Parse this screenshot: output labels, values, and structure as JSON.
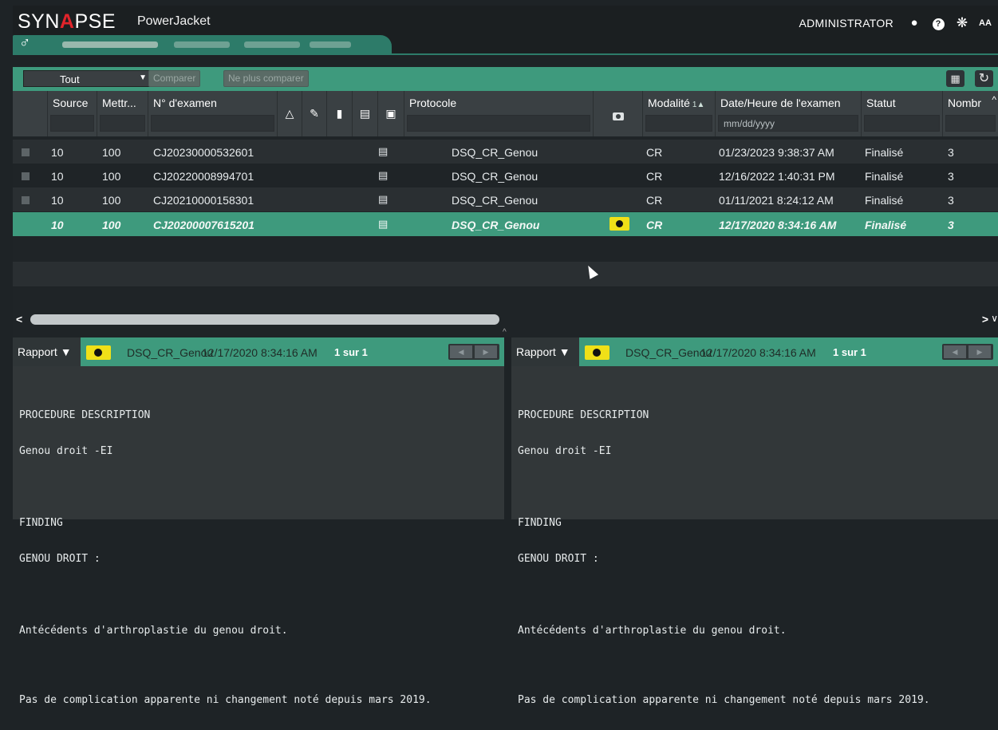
{
  "header": {
    "logo": "SYN",
    "logo_a": "A",
    "logo_rest": "PSE",
    "product": "PowerJacket",
    "user": "ADMINISTRATOR"
  },
  "toolbar": {
    "filter_value": "Tout",
    "compare_label": "Comparer",
    "uncompare_label": "Ne plus comparer"
  },
  "grid": {
    "columns": {
      "source": "Source",
      "mettre": "Mettr...",
      "exam_no": "N° d'examen",
      "protocol": "Protocole",
      "modality": "Modalité",
      "modality_sort": "1▲",
      "datetime": "Date/Heure de l'examen",
      "status": "Statut",
      "count": "Nombr"
    },
    "date_placeholder": "mm/dd/yyyy",
    "rows": [
      {
        "source": "10",
        "mettre": "100",
        "exam_no": "CJ20230000532601",
        "protocol": "DSQ_CR_Genou",
        "modality": "CR",
        "datetime": "01/23/2023 9:38:37 AM",
        "status": "Finalisé",
        "count": "3"
      },
      {
        "source": "10",
        "mettre": "100",
        "exam_no": "CJ20220008994701",
        "protocol": "DSQ_CR_Genou",
        "modality": "CR",
        "datetime": "12/16/2022 1:40:31 PM",
        "status": "Finalisé",
        "count": "3"
      },
      {
        "source": "10",
        "mettre": "100",
        "exam_no": "CJ20210000158301",
        "protocol": "DSQ_CR_Genou",
        "modality": "CR",
        "datetime": "01/11/2021 8:24:12 AM",
        "status": "Finalisé",
        "count": "3"
      },
      {
        "source": "10",
        "mettre": "100",
        "exam_no": "CJ20200007615201",
        "protocol": "DSQ_CR_Genou",
        "modality": "CR",
        "datetime": "12/17/2020 8:34:16 AM",
        "status": "Finalisé",
        "count": "3"
      }
    ]
  },
  "reports": {
    "left": {
      "selector": "Rapport ▼",
      "protocol": "DSQ_CR_Genou",
      "datetime": "12/17/2020 8:34:16 AM",
      "page": "1 sur 1",
      "lines": [
        "PROCEDURE DESCRIPTION",
        "Genou droit -EI",
        "FINDING",
        "GENOU DROIT :",
        "Antécédents d'arthroplastie du genou droit.",
        "Pas de complication apparente ni changement noté depuis mars 2019."
      ]
    },
    "right": {
      "selector": "Rapport ▼",
      "protocol": "DSQ_CR_Genou",
      "datetime": "12/17/2020 8:34:16 AM",
      "page": "1 sur 1",
      "lines": [
        "PROCEDURE DESCRIPTION",
        "Genou droit -EI",
        "FINDING",
        "GENOU DROIT :",
        "Antécédents d'arthroplastie du genou droit.",
        "Pas de complication apparente ni changement noté depuis mars 2019."
      ]
    }
  },
  "icons": [
    "male-icon",
    "chat-icon",
    "help-icon",
    "gear-icon",
    "font-size-icon",
    "columns-icon",
    "refresh-icon",
    "image-icon",
    "edit-icon",
    "file-icon",
    "document-icon",
    "lock-icon",
    "camera-icon",
    "flag-icon"
  ],
  "colors": {
    "accent": "#3e9a7d",
    "tab": "#2d7b69",
    "flag": "#f0e018"
  }
}
